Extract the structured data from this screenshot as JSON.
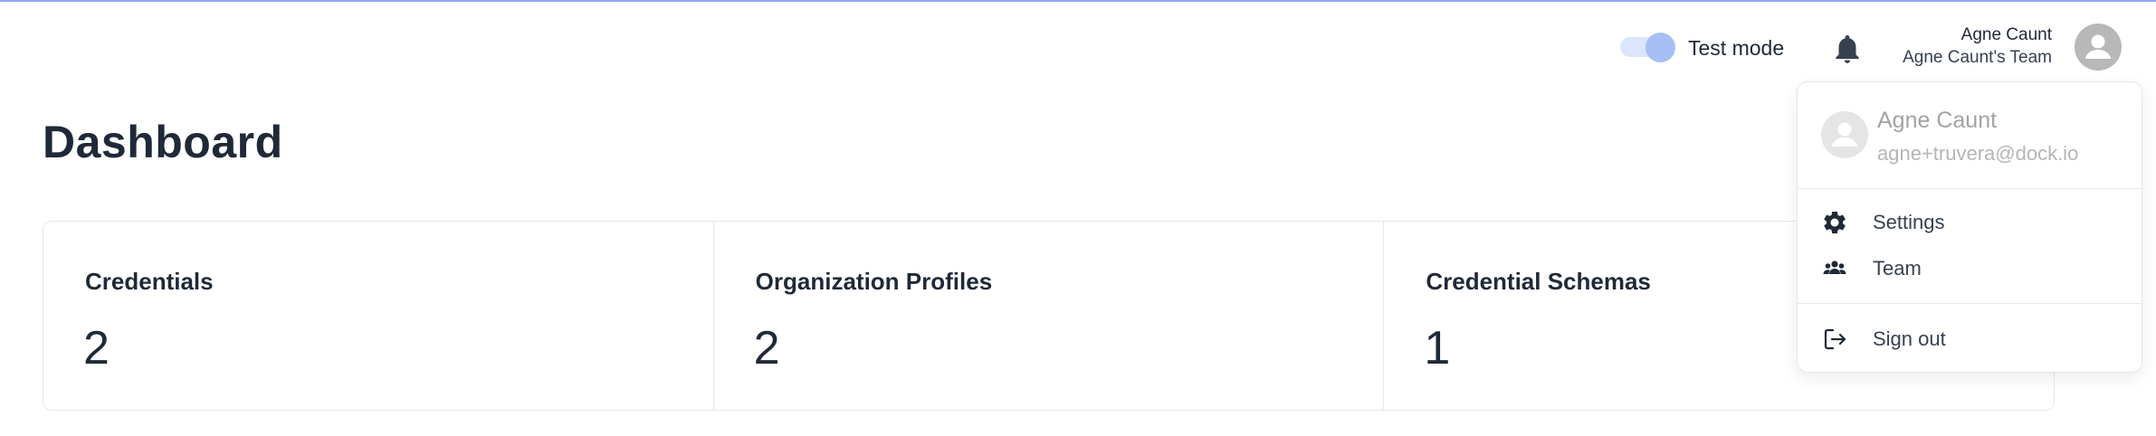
{
  "header": {
    "test_mode_label": "Test mode",
    "test_mode_on": true,
    "user_name": "Agne Caunt",
    "user_team": "Agne Caunt's Team"
  },
  "page": {
    "title": "Dashboard"
  },
  "stats": [
    {
      "label": "Credentials",
      "value": "2"
    },
    {
      "label": "Organization Profiles",
      "value": "2"
    },
    {
      "label": "Credential Schemas",
      "value": "1"
    }
  ],
  "menu": {
    "name": "Agne Caunt",
    "email": "agne+truvera@dock.io",
    "items": [
      {
        "label": "Settings",
        "icon": "gear-icon"
      },
      {
        "label": "Team",
        "icon": "team-icon"
      },
      {
        "label": "Sign out",
        "icon": "sign-out-icon"
      }
    ]
  },
  "colors": {
    "accent": "#8ea8f0",
    "toggle_knob": "#a7bff5",
    "text": "#1f2937",
    "border": "#e5e7eb"
  }
}
